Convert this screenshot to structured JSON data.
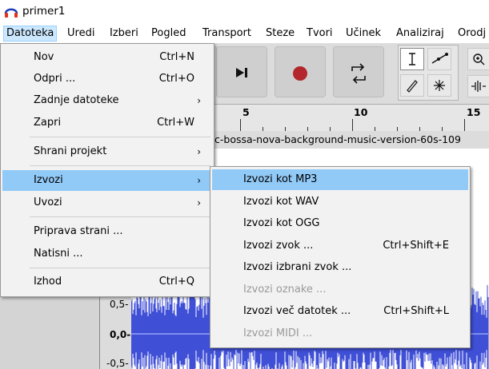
{
  "window": {
    "title": "primer1"
  },
  "menubar": [
    {
      "label": "Datoteka"
    },
    {
      "label": "Uredi"
    },
    {
      "label": "Izberi"
    },
    {
      "label": "Pogled"
    },
    {
      "label": "Transport"
    },
    {
      "label": "Steze"
    },
    {
      "label": "Tvori"
    },
    {
      "label": "Učinek"
    },
    {
      "label": "Analiziraj"
    },
    {
      "label": "Orodj"
    }
  ],
  "ruler": {
    "labels": [
      "5",
      "10",
      "15"
    ]
  },
  "track": {
    "title": "c-bossa-nova-background-music-version-60s-109",
    "scale": [
      "0,5-",
      "0,0-",
      "-0,5-"
    ]
  },
  "file_menu": {
    "items": [
      {
        "label": "Nov",
        "shortcut": "Ctrl+N"
      },
      {
        "label": "Odpri ...",
        "shortcut": "Ctrl+O"
      },
      {
        "label": "Zadnje datoteke",
        "submenu": "›"
      },
      {
        "label": "Zapri",
        "shortcut": "Ctrl+W"
      },
      {
        "label": "Shrani projekt",
        "submenu": "›"
      },
      {
        "label": "Izvozi",
        "submenu": "›"
      },
      {
        "label": "Uvozi",
        "submenu": "›"
      },
      {
        "label": "Priprava strani ..."
      },
      {
        "label": "Natisni ..."
      },
      {
        "label": "Izhod",
        "shortcut": "Ctrl+Q"
      }
    ]
  },
  "export_menu": {
    "items": [
      {
        "label": "Izvozi kot MP3"
      },
      {
        "label": "Izvozi kot WAV"
      },
      {
        "label": "Izvozi kot OGG"
      },
      {
        "label": "Izvozi zvok ...",
        "shortcut": "Ctrl+Shift+E"
      },
      {
        "label": "Izvozi izbrani zvok ..."
      },
      {
        "label": "Izvozi oznake ..."
      },
      {
        "label": "Izvozi več datotek ...",
        "shortcut": "Ctrl+Shift+L"
      },
      {
        "label": "Izvozi MIDI ..."
      }
    ]
  },
  "colors": {
    "highlight": "#91c9f7",
    "waveform": "#3f4fd6",
    "record": "#b3262b"
  }
}
